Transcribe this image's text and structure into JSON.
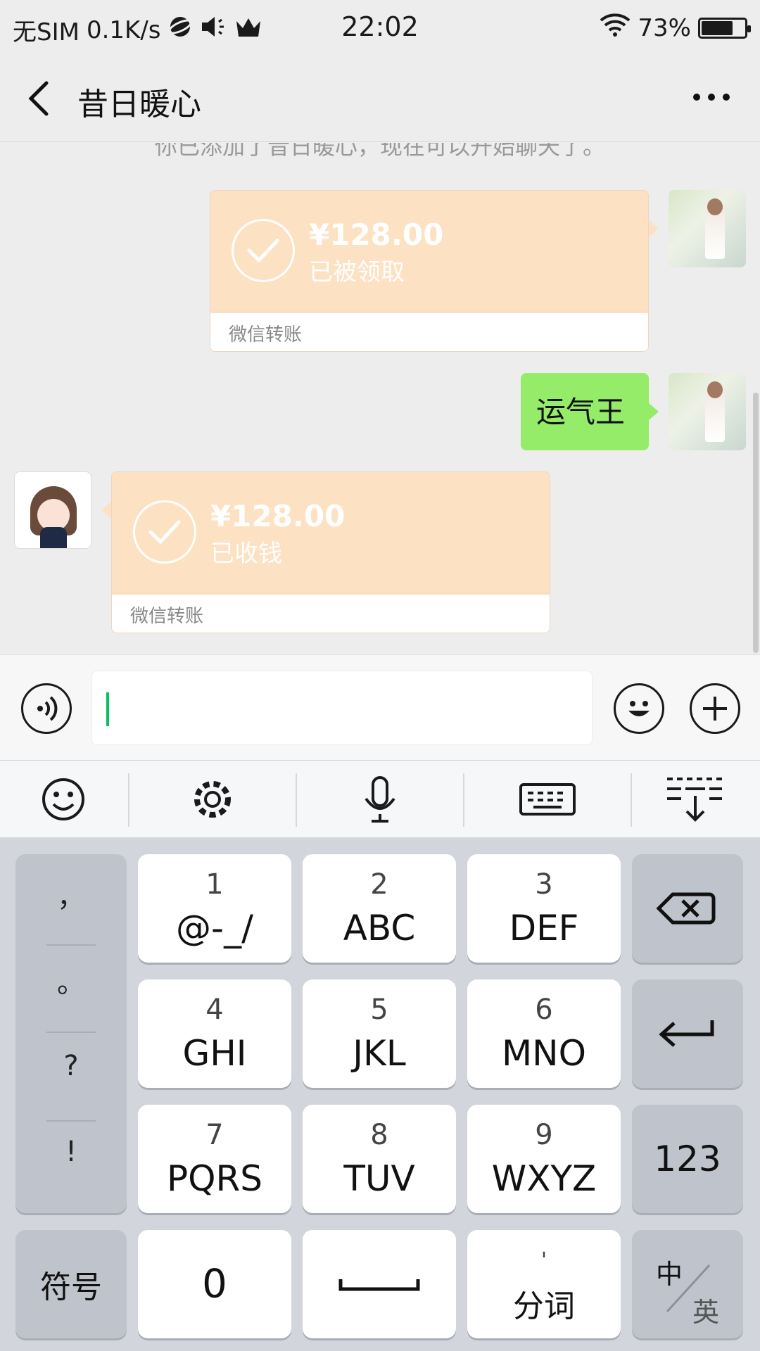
{
  "status_bar": {
    "carrier": "无SIM",
    "speed": "0.1K/s",
    "time": "22:02",
    "battery_pct": "73%",
    "battery_level": 0.73,
    "icons": [
      "orb-icon",
      "mute-icon",
      "crown-icon",
      "wifi-icon",
      "battery-icon"
    ]
  },
  "header": {
    "title": "昔日暖心",
    "back_icon": "chevron-left-icon",
    "more_icon": "more-dots-icon"
  },
  "chat": {
    "system_note": "你已添加了昔日暖心，现在可以开始聊天了。",
    "messages": [
      {
        "from": "me",
        "type": "transfer",
        "amount": "¥128.00",
        "status": "已被领取",
        "footer": "微信转账"
      },
      {
        "from": "me",
        "type": "text",
        "text": "运气王"
      },
      {
        "from": "other",
        "type": "transfer",
        "amount": "¥128.00",
        "status": "已收钱",
        "footer": "微信转账"
      }
    ]
  },
  "input_bar": {
    "voice_icon": "voice-icon",
    "emoji_icon": "emoji-icon",
    "plus_icon": "plus-icon",
    "input_value": ""
  },
  "keyboard": {
    "toolbar": [
      "emoji-icon",
      "gear-icon",
      "mic-icon",
      "keyboard-icon",
      "collapse-keyboard-icon"
    ],
    "punctuation": [
      "，",
      "。",
      "?",
      "!"
    ],
    "keys": [
      {
        "num": "1",
        "letters": "@-_/"
      },
      {
        "num": "2",
        "letters": "ABC"
      },
      {
        "num": "3",
        "letters": "DEF"
      },
      {
        "num": "4",
        "letters": "GHI"
      },
      {
        "num": "5",
        "letters": "JKL"
      },
      {
        "num": "6",
        "letters": "MNO"
      },
      {
        "num": "7",
        "letters": "PQRS"
      },
      {
        "num": "8",
        "letters": "TUV"
      },
      {
        "num": "9",
        "letters": "WXYZ"
      }
    ],
    "symbols_label": "符号",
    "zero_label": "0",
    "segment_label": "分词",
    "segment_mark": "'",
    "numeric_label": "123",
    "lang_cn": "中",
    "lang_en": "英",
    "accent_color": "#07c160"
  }
}
